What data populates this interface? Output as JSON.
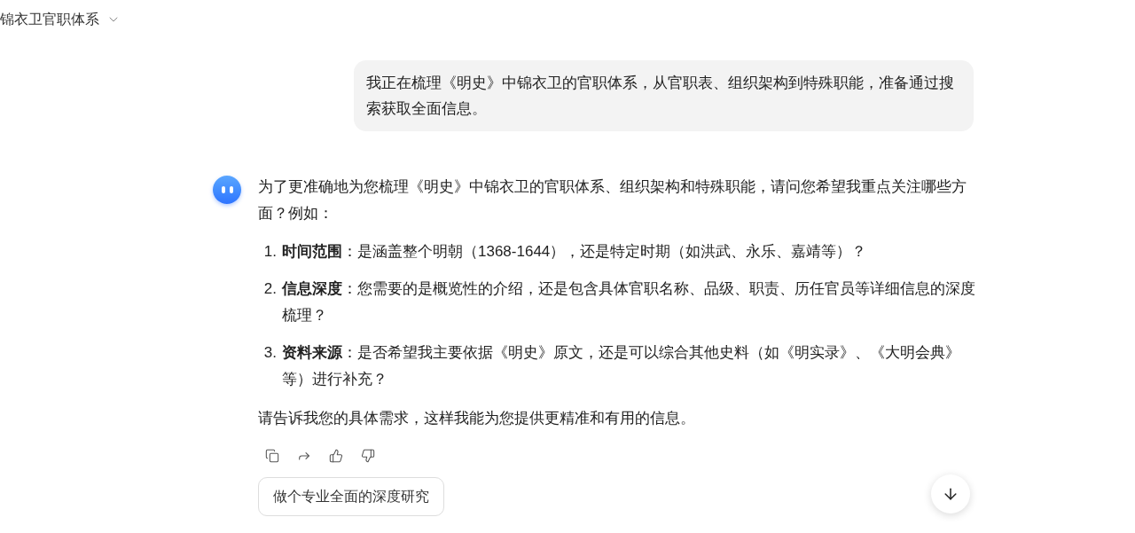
{
  "header": {
    "title": "锦衣卫官职体系"
  },
  "user_message": "我正在梳理《明史》中锦衣卫的官职体系，从官职表、组织架构到特殊职能，准备通过搜索获取全面信息。",
  "assistant": {
    "intro": "为了更准确地为您梳理《明史》中锦衣卫的官职体系、组织架构和特殊职能，请问您希望我重点关注哪些方面？例如：",
    "items": [
      {
        "number": "1.",
        "text": "**时间范围**：是涵盖整个明朝（1368-1644），还是特定时期（如洪武、永乐、嘉靖等）？"
      },
      {
        "number": "2.",
        "text": "**信息深度**：您需要的是概览性的介绍，还是包含具体官职名称、品级、职责、历任官员等详细信息的深度梳理？"
      },
      {
        "number": "3.",
        "text": "**资料来源**：是否希望我主要依据《明史》原文，还是可以综合其他史料（如《明实录》、《大明会典》等）进行补充？"
      }
    ],
    "closing": "请告诉我您的具体需求，这样我能为您提供更精准和有用的信息。"
  },
  "actions": [
    {
      "kind": "copy"
    },
    {
      "kind": "share"
    },
    {
      "kind": "like"
    },
    {
      "kind": "dislike"
    }
  ],
  "suggestion": "做个专业全面的深度研究"
}
